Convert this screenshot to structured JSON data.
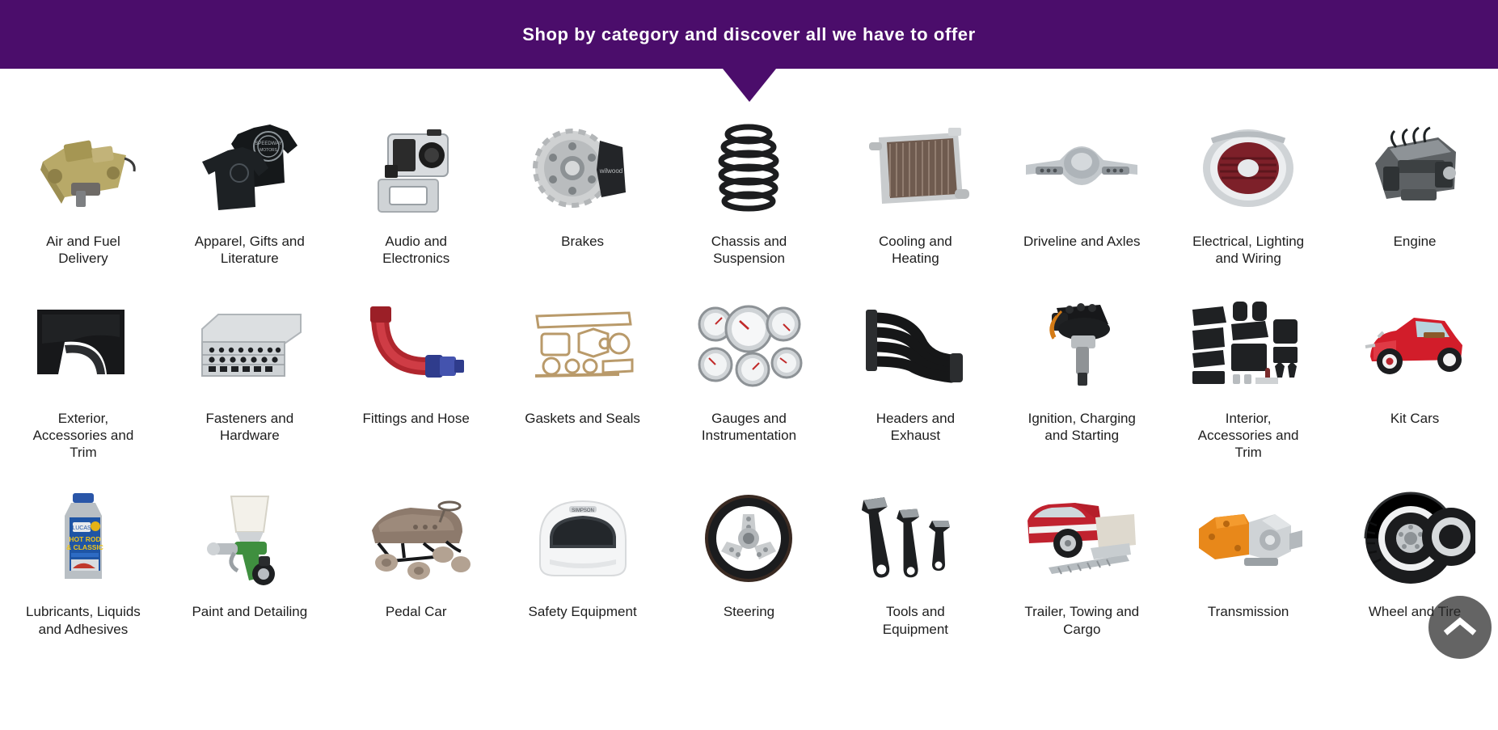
{
  "banner": {
    "title": "Shop by category and discover all we have to offer",
    "background_color": "#4B0D6B",
    "text_color": "#FFFFFF"
  },
  "label_color": "#1E1E1E",
  "categories": [
    {
      "label": "Air and Fuel Delivery",
      "icon": "carburetor-image"
    },
    {
      "label": "Apparel, Gifts and Literature",
      "icon": "tshirts-image"
    },
    {
      "label": "Audio and Electronics",
      "icon": "camera-housing-image"
    },
    {
      "label": "Brakes",
      "icon": "brake-rotor-caliper-image"
    },
    {
      "label": "Chassis and Suspension",
      "icon": "coil-spring-image"
    },
    {
      "label": "Cooling and Heating",
      "icon": "radiator-image"
    },
    {
      "label": "Driveline and Axles",
      "icon": "rear-axle-housing-image"
    },
    {
      "label": "Electrical, Lighting and Wiring",
      "icon": "tail-light-image"
    },
    {
      "label": "Engine",
      "icon": "crate-engine-image"
    },
    {
      "label": "Exterior, Accessories and Trim",
      "icon": "fender-panel-image"
    },
    {
      "label": "Fasteners and Hardware",
      "icon": "hardware-assortment-case-image"
    },
    {
      "label": "Fittings and Hose",
      "icon": "hose-end-fitting-image"
    },
    {
      "label": "Gaskets and Seals",
      "icon": "gasket-set-image"
    },
    {
      "label": "Gauges and Instrumentation",
      "icon": "gauge-cluster-image"
    },
    {
      "label": "Headers and Exhaust",
      "icon": "exhaust-headers-image"
    },
    {
      "label": "Ignition, Charging and Starting",
      "icon": "distributor-image"
    },
    {
      "label": "Interior, Accessories and Trim",
      "icon": "interior-kit-image"
    },
    {
      "label": "Kit Cars",
      "icon": "red-roadster-image"
    },
    {
      "label": "Lubricants, Liquids and Adhesives",
      "icon": "oil-bottle-image"
    },
    {
      "label": "Paint and Detailing",
      "icon": "spray-gun-image"
    },
    {
      "label": "Pedal Car",
      "icon": "pedal-car-image"
    },
    {
      "label": "Safety Equipment",
      "icon": "racing-helmet-image"
    },
    {
      "label": "Steering",
      "icon": "steering-wheel-image"
    },
    {
      "label": "Tools and Equipment",
      "icon": "adjustable-wrenches-image"
    },
    {
      "label": "Trailer, Towing and Cargo",
      "icon": "car-on-trailer-image"
    },
    {
      "label": "Transmission",
      "icon": "transmission-image"
    },
    {
      "label": "Wheel and Tire",
      "icon": "wheel-tire-image"
    }
  ],
  "back_to_top": {
    "icon": "chevron-up-icon",
    "background_color": "rgba(40,40,40,0.72)"
  }
}
